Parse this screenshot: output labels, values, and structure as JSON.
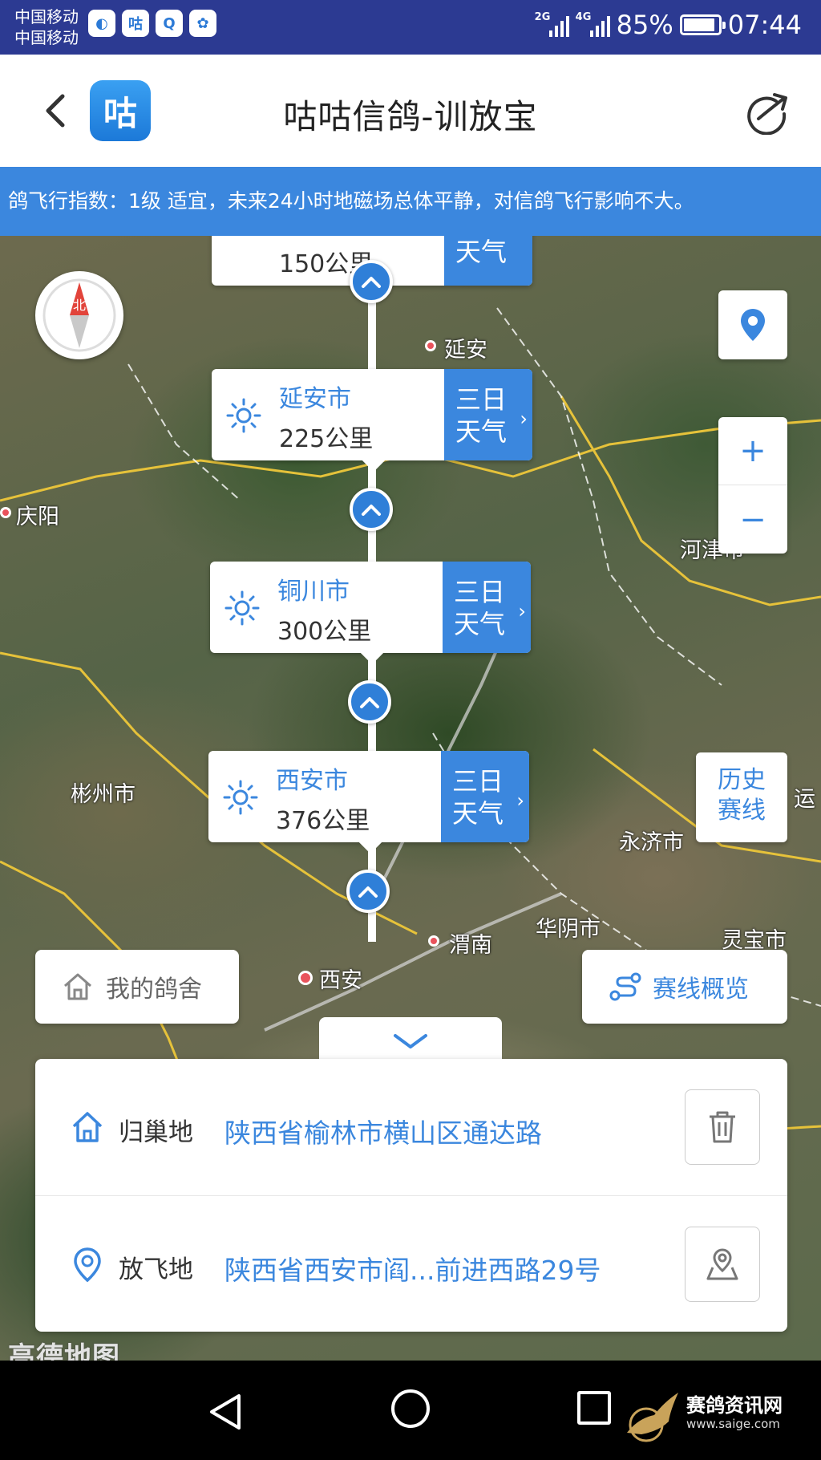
{
  "status_bar": {
    "carrier_1": "中国移动",
    "carrier_2": "中国移动",
    "app_icon_label": "咕",
    "network_1": "2G",
    "network_2": "4G",
    "battery": "85%",
    "time": "07:44"
  },
  "header": {
    "logo_text": "咕",
    "title": "咕咕信鸽-训放宝"
  },
  "ticker": {
    "text": "鸽飞行指数：1级 适宜，未来24小时地磁场总体平静，对信鸽飞行影响不大。"
  },
  "map": {
    "compass_label": "北",
    "cities": {
      "yanan": "延安",
      "qingyang": "庆阳",
      "hejin": "河津市",
      "binzhou": "彬州市",
      "yongji": "永济市",
      "huayin": "华阴市",
      "weinan": "渭南",
      "lingbao": "灵宝市",
      "xian": "西安",
      "yun": "运"
    },
    "waypoints": [
      {
        "name": "",
        "distance": "150公里",
        "weather": "天气"
      },
      {
        "name": "延安市",
        "distance": "225公里",
        "weather_1": "三日",
        "weather_2": "天气"
      },
      {
        "name": "铜川市",
        "distance": "300公里",
        "weather_1": "三日",
        "weather_2": "天气"
      },
      {
        "name": "西安市",
        "distance": "376公里",
        "weather_1": "三日",
        "weather_2": "天气"
      }
    ],
    "history_line_1": "历史",
    "history_line_2": "赛线",
    "zoom_in": "+",
    "zoom_out": "−",
    "my_loft": "我的鸽舍",
    "race_overview": "赛线概览",
    "watermark": "高德地图"
  },
  "info_panel": {
    "home_label": "归巢地",
    "home_value": "陕西省榆林市横山区通达路",
    "release_label": "放飞地",
    "release_value": "陕西省西安市阎...前进西路29号"
  },
  "watermark": {
    "name": "赛鸽资讯网",
    "url": "www.saige.com"
  },
  "colors": {
    "accent": "#3b87de",
    "status_bar": "#2c3a92",
    "nav_bar": "#000000"
  }
}
